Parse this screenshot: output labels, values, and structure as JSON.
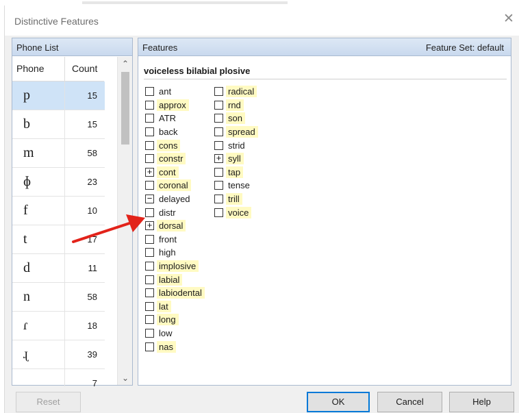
{
  "window": {
    "title": "Distinctive Features",
    "close_glyph": "✕"
  },
  "phone_list": {
    "header": "Phone List",
    "col_phone": "Phone",
    "col_count": "Count",
    "rows": [
      {
        "phone": "p",
        "count": "15",
        "selected": true
      },
      {
        "phone": "b",
        "count": "15"
      },
      {
        "phone": "m",
        "count": "58"
      },
      {
        "phone": "ɸ",
        "count": "23"
      },
      {
        "phone": "f",
        "count": "10"
      },
      {
        "phone": "t",
        "count": "17"
      },
      {
        "phone": "d",
        "count": "11"
      },
      {
        "phone": "n",
        "count": "58"
      },
      {
        "phone": "ɾ",
        "count": "18"
      },
      {
        "phone": "ɻ",
        "count": "39"
      },
      {
        "phone": "̪",
        "count": "7"
      }
    ],
    "scroll_up": "⌃",
    "scroll_down": "⌄"
  },
  "features": {
    "header": "Features",
    "feature_set_label": "Feature Set:  default",
    "phone_description": "voiceless bilabial plosive",
    "column1": [
      {
        "label": "ant",
        "state": "",
        "hl": false
      },
      {
        "label": "approx",
        "state": "",
        "hl": true
      },
      {
        "label": "ATR",
        "state": "",
        "hl": false
      },
      {
        "label": "back",
        "state": "",
        "hl": false
      },
      {
        "label": "cons",
        "state": "",
        "hl": true
      },
      {
        "label": "constr",
        "state": "",
        "hl": true
      },
      {
        "label": "cont",
        "state": "+",
        "hl": true
      },
      {
        "label": "coronal",
        "state": "",
        "hl": true
      },
      {
        "label": "delayed",
        "state": "−",
        "hl": false
      },
      {
        "label": "distr",
        "state": "",
        "hl": false
      },
      {
        "label": "dorsal",
        "state": "+",
        "hl": true
      },
      {
        "label": "front",
        "state": "",
        "hl": false
      },
      {
        "label": "high",
        "state": "",
        "hl": false
      },
      {
        "label": "implosive",
        "state": "",
        "hl": true
      },
      {
        "label": "labial",
        "state": "",
        "hl": true
      },
      {
        "label": "labiodental",
        "state": "",
        "hl": true
      },
      {
        "label": "lat",
        "state": "",
        "hl": true
      },
      {
        "label": "long",
        "state": "",
        "hl": true
      },
      {
        "label": "low",
        "state": "",
        "hl": false
      },
      {
        "label": "nas",
        "state": "",
        "hl": true
      }
    ],
    "column2": [
      {
        "label": "radical",
        "state": "",
        "hl": true
      },
      {
        "label": "rnd",
        "state": "",
        "hl": true
      },
      {
        "label": "son",
        "state": "",
        "hl": true
      },
      {
        "label": "spread",
        "state": "",
        "hl": true
      },
      {
        "label": "strid",
        "state": "",
        "hl": false
      },
      {
        "label": "syll",
        "state": "+",
        "hl": true
      },
      {
        "label": "tap",
        "state": "",
        "hl": true
      },
      {
        "label": "tense",
        "state": "",
        "hl": false
      },
      {
        "label": "trill",
        "state": "",
        "hl": true
      },
      {
        "label": "voice",
        "state": "",
        "hl": true
      }
    ]
  },
  "buttons": {
    "reset": "Reset",
    "ok": "OK",
    "cancel": "Cancel",
    "help": "Help"
  },
  "colors": {
    "highlight": "#fffac2",
    "selected_row": "#cfe3f7",
    "arrow": "#e2231a"
  }
}
